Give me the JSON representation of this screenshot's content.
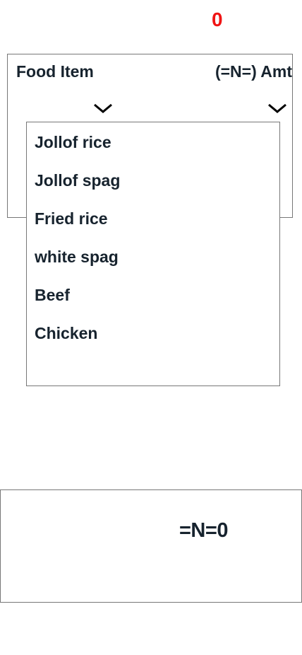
{
  "counter": "0",
  "form": {
    "food_header": "Food Item",
    "amount_header": "(=N=) Amt",
    "food_chevron_icon": "chevron-down-icon",
    "amount_chevron_icon": "chevron-down-icon"
  },
  "dropdown": {
    "items": [
      {
        "label": "Jollof rice"
      },
      {
        "label": "Jollof spag"
      },
      {
        "label": "Fried rice"
      },
      {
        "label": "white spag"
      },
      {
        "label": "Beef"
      },
      {
        "label": "Chicken"
      }
    ]
  },
  "total": "=N=0",
  "colors": {
    "counter": "#f01414",
    "text": "#17232e",
    "border": "#777777"
  }
}
